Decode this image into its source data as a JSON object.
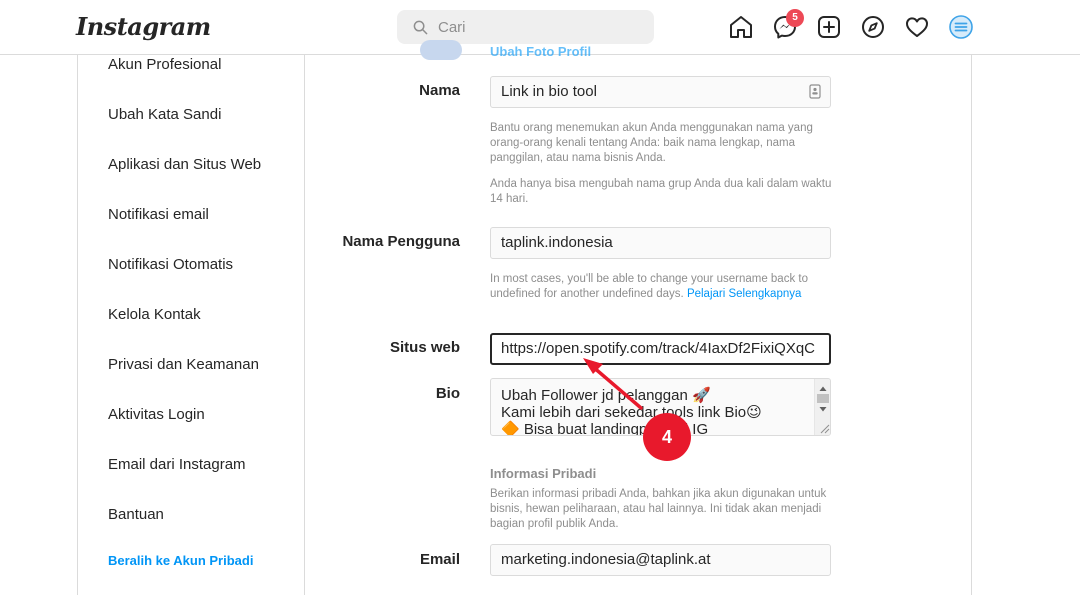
{
  "app": {
    "logo": "Instagram"
  },
  "search": {
    "placeholder": "Cari"
  },
  "nav": {
    "icons": [
      "home-icon",
      "messenger-icon",
      "new-post-icon",
      "explore-icon",
      "activity-heart-icon",
      "profile-menu-icon"
    ],
    "messages_badge": "5"
  },
  "sidebar": {
    "items": [
      {
        "label": "Akun Profesional"
      },
      {
        "label": "Ubah Kata Sandi"
      },
      {
        "label": "Aplikasi dan Situs Web"
      },
      {
        "label": "Notifikasi email"
      },
      {
        "label": "Notifikasi Otomatis"
      },
      {
        "label": "Kelola Kontak"
      },
      {
        "label": "Privasi dan Keamanan"
      },
      {
        "label": "Aktivitas Login"
      },
      {
        "label": "Email dari Instagram"
      },
      {
        "label": "Bantuan"
      }
    ],
    "switch_link": "Beralih ke Akun Pribadi"
  },
  "form": {
    "change_photo": "Ubah Foto Profil",
    "name": {
      "label": "Nama",
      "value": "Link in bio tool",
      "help1": "Bantu orang menemukan akun Anda menggunakan nama yang orang-orang kenali tentang Anda: baik nama lengkap, nama panggilan, atau nama bisnis Anda.",
      "help2": "Anda hanya bisa mengubah nama grup Anda dua kali dalam waktu 14 hari."
    },
    "username": {
      "label": "Nama Pengguna",
      "value": "taplink.indonesia",
      "help": "In most cases, you'll be able to change your username back to undefined for another undefined days.",
      "help_link": "Pelajari Selengkapnya"
    },
    "website": {
      "label": "Situs web",
      "value": "https://open.spotify.com/track/4IaxDf2FixiQXqC"
    },
    "bio": {
      "label": "Bio",
      "lines": [
        "Ubah Follower jd pelanggan 🚀",
        "Kami lebih dari sekedar tools link Bio😉",
        "🔶 Bisa buat landingpage di IG"
      ]
    },
    "personal_info": {
      "title": "Informasi Pribadi",
      "help": "Berikan informasi pribadi Anda, bahkan jika akun digunakan untuk bisnis, hewan peliharaan, atau hal lainnya. Ini tidak akan menjadi bagian profil publik Anda."
    },
    "email": {
      "label": "Email",
      "value": "marketing.indonesia@taplink.at"
    }
  },
  "annotation": {
    "step": "4"
  },
  "colors": {
    "accent": "#0095f6",
    "badge": "#ed4956",
    "marker": "#e8192c"
  }
}
